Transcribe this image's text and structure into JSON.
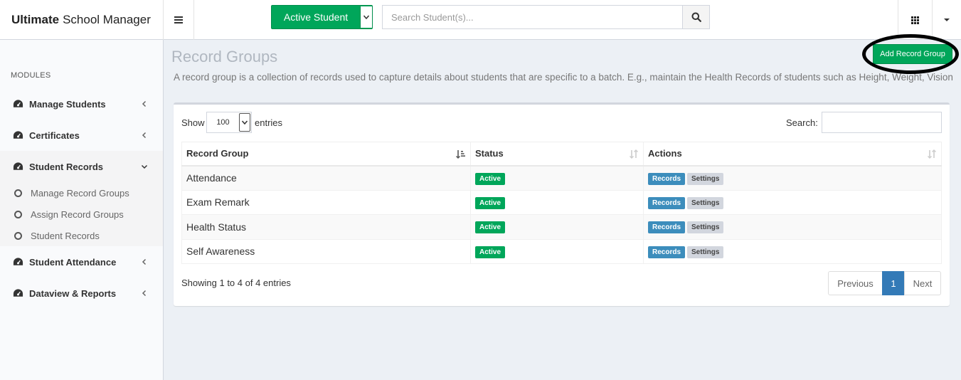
{
  "header": {
    "brand_bold": "Ultimate",
    "brand_rest": "School Manager",
    "student_filter": "Active Student",
    "search_placeholder": "Search Student(s)..."
  },
  "sidebar": {
    "section_label": "MODULES",
    "items": [
      {
        "label": "Manage Students",
        "icon": "dashboard-icon",
        "expanded": false
      },
      {
        "label": "Certificates",
        "icon": "dashboard-icon",
        "expanded": false
      },
      {
        "label": "Student Records",
        "icon": "dashboard-icon",
        "expanded": true
      },
      {
        "label": "Student Attendance",
        "icon": "dashboard-icon",
        "expanded": false
      },
      {
        "label": "Dataview & Reports",
        "icon": "dashboard-icon",
        "expanded": false
      }
    ],
    "subitems": [
      {
        "label": "Manage Record Groups"
      },
      {
        "label": "Assign Record Groups"
      },
      {
        "label": "Student Records"
      }
    ]
  },
  "page": {
    "title": "Record Groups",
    "description": "A record group is a collection of records used to capture details about students that are specific to a batch. E.g., maintain the Health Records of students such as Height, Weight, Vision",
    "add_button": "Add Record Group"
  },
  "table_controls": {
    "show_label": "Show",
    "page_length": "100",
    "entries_label": "entries",
    "search_label": "Search:"
  },
  "table": {
    "columns": [
      "Record Group",
      "Status",
      "Actions"
    ],
    "rows": [
      {
        "name": "Attendance",
        "status": "Active",
        "action1": "Records",
        "action2": "Settings"
      },
      {
        "name": "Exam Remark",
        "status": "Active",
        "action1": "Records",
        "action2": "Settings"
      },
      {
        "name": "Health Status",
        "status": "Active",
        "action1": "Records",
        "action2": "Settings"
      },
      {
        "name": "Self Awareness",
        "status": "Active",
        "action1": "Records",
        "action2": "Settings"
      }
    ]
  },
  "footer": {
    "info": "Showing 1 to 4 of 4 entries",
    "prev": "Previous",
    "page": "1",
    "next": "Next"
  },
  "colors": {
    "green": "#00a65a",
    "blue": "#3c8dbc",
    "page_blue": "#337ab7",
    "gray_badge": "#d2d6de"
  }
}
